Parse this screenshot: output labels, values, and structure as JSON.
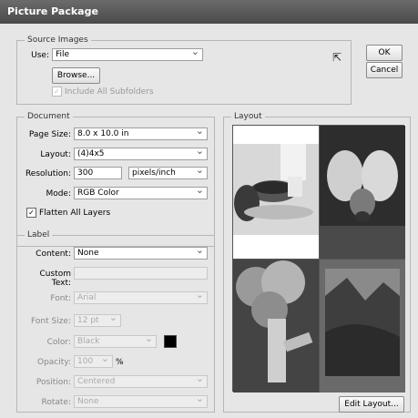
{
  "window": {
    "title": "Picture Package"
  },
  "buttons": {
    "ok": "OK",
    "cancel": "Cancel",
    "browse": "Browse...",
    "edit_layout": "Edit Layout..."
  },
  "source": {
    "legend": "Source Images",
    "use_label": "Use:",
    "use_value": "File",
    "include_subfolders": "Include All Subfolders"
  },
  "document": {
    "legend": "Document",
    "page_size_label": "Page Size:",
    "page_size_value": "8.0 x 10.0 in",
    "layout_label": "Layout:",
    "layout_value": "(4)4x5",
    "resolution_label": "Resolution:",
    "resolution_value": "300",
    "resolution_unit": "pixels/inch",
    "mode_label": "Mode:",
    "mode_value": "RGB Color",
    "flatten_label": "Flatten All Layers"
  },
  "label": {
    "legend": "Label",
    "content_label": "Content:",
    "content_value": "None",
    "custom_text_label": "Custom Text:",
    "font_label": "Font:",
    "font_value": "Arial",
    "font_size_label": "Font Size:",
    "font_size_value": "12 pt",
    "color_label": "Color:",
    "color_value": "Black",
    "opacity_label": "Opacity:",
    "opacity_value": "100",
    "opacity_unit": "%",
    "position_label": "Position:",
    "position_value": "Centered",
    "rotate_label": "Rotate:",
    "rotate_value": "None"
  },
  "layout_panel": {
    "legend": "Layout"
  },
  "colors": {
    "titlebar": "#4a4a4a",
    "swatch": "#000000"
  },
  "icons": {
    "cursor": "arrow-cursor-icon",
    "checkbox": "check-icon",
    "dropdown": "chevron-down-icon"
  }
}
